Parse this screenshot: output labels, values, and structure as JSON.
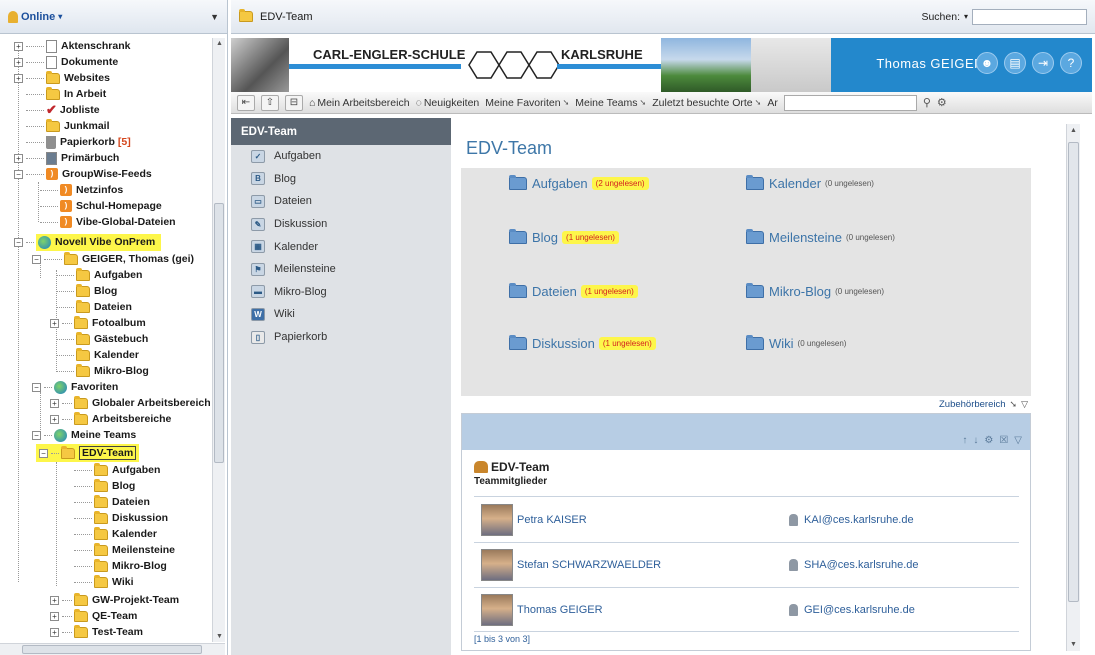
{
  "status": {
    "label": "Online"
  },
  "tree": {
    "items": [
      {
        "label": "Aktenschrank"
      },
      {
        "label": "Dokumente"
      },
      {
        "label": "Websites"
      },
      {
        "label": "In Arbeit"
      },
      {
        "label": "Jobliste"
      },
      {
        "label": "Junkmail"
      },
      {
        "label": "Papierkorb",
        "count": "[5]"
      },
      {
        "label": "Primärbuch"
      },
      {
        "label": "GroupWise-Feeds"
      },
      {
        "label": "Netzinfos"
      },
      {
        "label": "Schul-Homepage"
      },
      {
        "label": "Vibe-Global-Dateien"
      },
      {
        "label": "Novell Vibe OnPrem"
      },
      {
        "label": "GEIGER, Thomas (gei)"
      },
      {
        "label": "Aufgaben"
      },
      {
        "label": "Blog"
      },
      {
        "label": "Dateien"
      },
      {
        "label": "Fotoalbum"
      },
      {
        "label": "Gästebuch"
      },
      {
        "label": "Kalender"
      },
      {
        "label": "Mikro-Blog"
      },
      {
        "label": "Favoriten"
      },
      {
        "label": "Globaler Arbeitsbereich"
      },
      {
        "label": "Arbeitsbereiche"
      },
      {
        "label": "Meine Teams"
      },
      {
        "label": "EDV-Team"
      },
      {
        "label": "Aufgaben"
      },
      {
        "label": "Blog"
      },
      {
        "label": "Dateien"
      },
      {
        "label": "Diskussion"
      },
      {
        "label": "Kalender"
      },
      {
        "label": "Meilensteine"
      },
      {
        "label": "Mikro-Blog"
      },
      {
        "label": "Wiki"
      },
      {
        "label": "GW-Projekt-Team"
      },
      {
        "label": "QE-Team"
      },
      {
        "label": "Test-Team"
      }
    ]
  },
  "header": {
    "breadcrumb": "EDV-Team",
    "search_label": "Suchen:"
  },
  "banner": {
    "school": "CARL-ENGLER-SCHULE",
    "city": "KARLSRUHE",
    "user": "Thomas GEIGER"
  },
  "nav": {
    "items": [
      "Mein Arbeitsbereich",
      "Neuigkeiten",
      "Meine Favoriten",
      "Meine Teams",
      "Zuletzt besuchte Orte",
      "Ar"
    ]
  },
  "sidebar": {
    "title": "EDV-Team",
    "items": [
      "Aufgaben",
      "Blog",
      "Dateien",
      "Diskussion",
      "Kalender",
      "Meilensteine",
      "Mikro-Blog",
      "Wiki",
      "Papierkorb"
    ]
  },
  "content": {
    "title": "EDV-Team",
    "folders": [
      {
        "label": "Aufgaben",
        "count": "(2 ungelesen)"
      },
      {
        "label": "Kalender",
        "count": "(0 ungelesen)"
      },
      {
        "label": "Blog",
        "count": "(1 ungelesen)"
      },
      {
        "label": "Meilensteine",
        "count": "(0 ungelesen)"
      },
      {
        "label": "Dateien",
        "count": "(1 ungelesen)"
      },
      {
        "label": "Mikro-Blog",
        "count": "(0 ungelesen)"
      },
      {
        "label": "Diskussion",
        "count": "(1 ungelesen)"
      },
      {
        "label": "Wiki",
        "count": "(0 ungelesen)"
      }
    ],
    "accessory": "Zubehörbereich"
  },
  "team": {
    "title": "EDV-Team",
    "subtitle": "Teammitglieder",
    "members": [
      {
        "name": "Petra KAISER",
        "email": "KAI@ces.karlsruhe.de"
      },
      {
        "name": "Stefan SCHWARZWAELDER",
        "email": "SHA@ces.karlsruhe.de"
      },
      {
        "name": "Thomas GEIGER",
        "email": "GEI@ces.karlsruhe.de"
      }
    ],
    "pager": "[1 bis 3 von 3]"
  },
  "colors": {
    "accent": "#2388cc",
    "sidebar_head": "#5c6773",
    "highlight": "#fdf64a",
    "link": "#3c74a8"
  }
}
